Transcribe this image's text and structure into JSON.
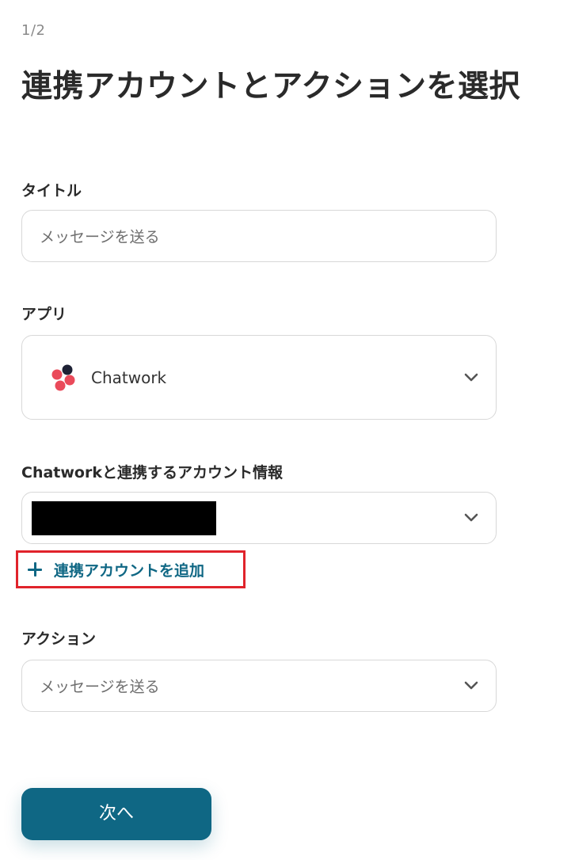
{
  "step_indicator": "1/2",
  "page_title": "連携アカウントとアクションを選択",
  "title_field": {
    "label": "タイトル",
    "value": "メッセージを送る"
  },
  "app_field": {
    "label": "アプリ",
    "value": "Chatwork",
    "icon": "chatwork-logo"
  },
  "account_field": {
    "label": "Chatworkと連携するアカウント情報",
    "value_redacted": true
  },
  "add_account": {
    "label": "連携アカウントを追加",
    "icon": "plus-icon",
    "highlight_color": "#e0232b"
  },
  "action_field": {
    "label": "アクション",
    "value": "メッセージを送る"
  },
  "next_button": {
    "label": "次へ"
  },
  "colors": {
    "accent": "#0f6784",
    "highlight": "#e0232b"
  }
}
